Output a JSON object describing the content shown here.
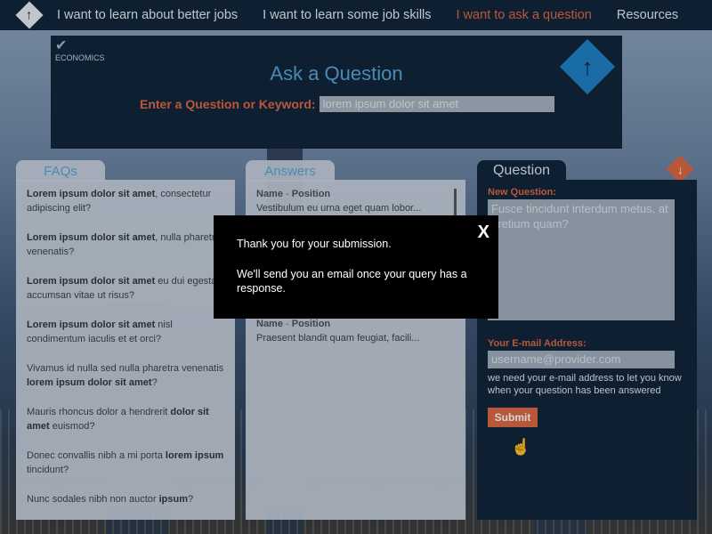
{
  "nav": {
    "items": [
      {
        "label": "I want to learn about better jobs",
        "active": false
      },
      {
        "label": "I want to learn some job skills",
        "active": false
      },
      {
        "label": "I want to ask a question",
        "active": true
      },
      {
        "label": "Resources",
        "active": false
      }
    ]
  },
  "header": {
    "logo_text": "ECONOMICS",
    "title": "Ask a Question",
    "search_label": "Enter a Question or Keyword:",
    "search_value": "lorem ipsum dolor sit amet"
  },
  "faqs": {
    "tab": "FAQs",
    "items": [
      {
        "bold": "Lorem ipsum dolor sit amet",
        "rest": ", consectetur adipiscing elit?"
      },
      {
        "bold": "Lorem ipsum dolor sit amet",
        "rest": ", nulla pharetra venenatis?"
      },
      {
        "bold": "Lorem ipsum dolor sit amet",
        "rest": " eu dui egestas accumsan vitae ut risus?"
      },
      {
        "bold": "Lorem ipsum dolor sit amet",
        "rest": " nisl condimentum iaculis et et orci?"
      },
      {
        "pre": "Vivamus id nulla sed nulla pharetra venenatis ",
        "bold": "lorem ipsum dolor sit amet",
        "rest": "?"
      },
      {
        "pre": "Mauris rhoncus dolor a hendrerit ",
        "bold": "dolor sit amet",
        "rest": " euismod?"
      },
      {
        "pre": "Donec convallis nibh a mi porta ",
        "bold": "lorem ipsum",
        "rest": " tincidunt?"
      },
      {
        "pre": "Nunc sodales nibh non auctor ",
        "bold": "ipsum",
        "rest": "?"
      }
    ]
  },
  "answers": {
    "tab": "Answers",
    "items": [
      {
        "name": "Name",
        "sep": " - ",
        "position": "Position",
        "text": "Vestibulum eu urna eget quam lobor..."
      },
      {
        "name": "Name",
        "sep": " - ",
        "position": "Position",
        "text": "Praesent blandit quam feugiat, facili..."
      }
    ]
  },
  "question": {
    "tab": "Question",
    "new_label": "New Question:",
    "new_placeholder": "Fusce tincidunt interdum metus, at pretium quam?",
    "email_label": "Your E-mail Address:",
    "email_placeholder": "username@provider.com",
    "help": "we need your e-mail address to let you know when your question has been answered",
    "submit": "Submit"
  },
  "modal": {
    "close": "X",
    "line1": "Thank you for your submission.",
    "line2": "We'll send you an email once your query has a response."
  },
  "colors": {
    "accent": "#e0663f",
    "nav_bg": "#0f2236",
    "title_blue": "#5aa4d4"
  },
  "icons": {
    "home": "up-arrow-diamond-icon",
    "badge": "up-arrow-diamond-icon",
    "down": "down-arrow-diamond-icon",
    "cursor": "hand-pointer-icon"
  }
}
